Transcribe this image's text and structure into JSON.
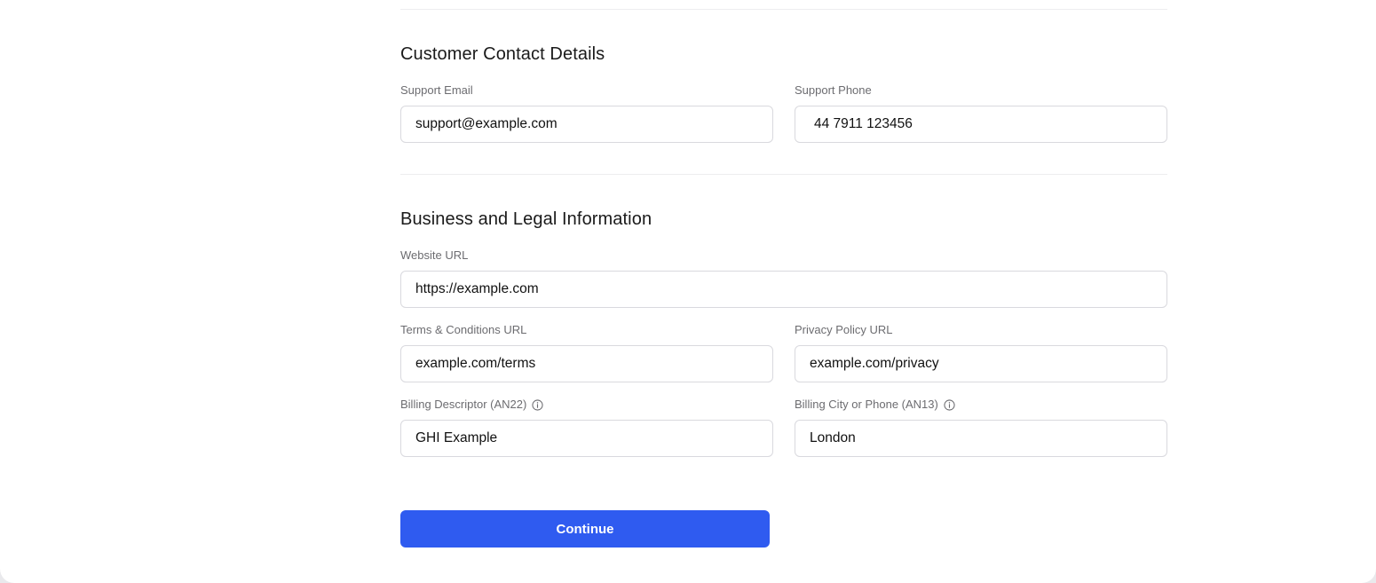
{
  "contact_section": {
    "title": "Customer Contact Details",
    "support_email": {
      "label": "Support Email",
      "value": "support@example.com"
    },
    "support_phone": {
      "label": "Support Phone",
      "value": "44 7911 123456"
    }
  },
  "business_section": {
    "title": "Business and Legal Information",
    "website_url": {
      "label": "Website URL",
      "value": "https://example.com"
    },
    "terms_url": {
      "label": "Terms & Conditions URL",
      "value": "example.com/terms"
    },
    "privacy_url": {
      "label": "Privacy Policy URL",
      "value": "example.com/privacy"
    },
    "billing_descriptor": {
      "label": "Billing Descriptor (AN22)",
      "value": "GHI Example",
      "icon": "info-icon"
    },
    "billing_city_phone": {
      "label": "Billing City or Phone (AN13)",
      "value": "London",
      "icon": "info-icon"
    }
  },
  "actions": {
    "continue_label": "Continue"
  },
  "colors": {
    "accent": "#2f5bf0",
    "border": "#d9d9de",
    "label": "#6c6c70"
  }
}
